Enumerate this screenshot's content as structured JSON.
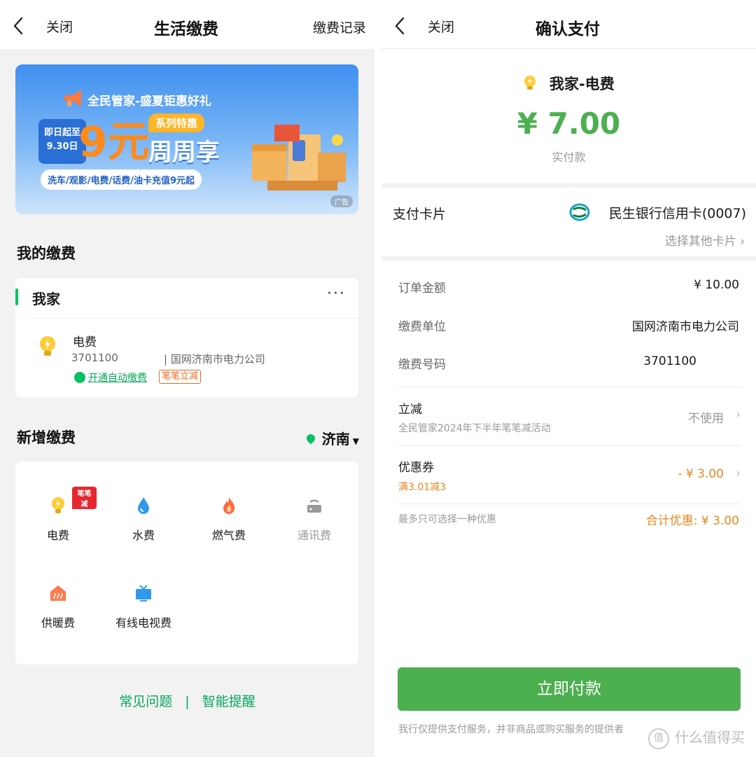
{
  "left": {
    "nav": {
      "close": "关闭",
      "title": "生活缴费",
      "right_link": "缴费记录"
    },
    "banner": {
      "title": "全民管家-盛夏钜惠好礼",
      "date_top": "即日起至",
      "date_bottom": "9.30日",
      "big": "9元",
      "series_tag": "系列特惠",
      "weekly": "周周享",
      "subtitle": "洗车/观影/电费/话费/油卡充值9元起",
      "ad_tag": "广告"
    },
    "my_bills": {
      "section_title": "我的缴费",
      "home_name": "我家",
      "more": "···",
      "bill": {
        "name": "电费",
        "number": "3701100",
        "company": "| 国网济南市电力公司",
        "auto_pay": "开通自动缴费",
        "promo_tag": "笔笔立减"
      }
    },
    "add_bills": {
      "section_title": "新增缴费",
      "city": "济南",
      "items": [
        {
          "label": "电费",
          "badge": "笔笔减",
          "icon": "bulb-icon"
        },
        {
          "label": "水费",
          "icon": "water-drop-icon"
        },
        {
          "label": "燃气费",
          "icon": "flame-icon"
        },
        {
          "label": "通讯费",
          "icon": "router-icon"
        },
        {
          "label": "供暖费",
          "icon": "heating-icon"
        },
        {
          "label": "有线电视费",
          "icon": "tv-icon"
        }
      ]
    },
    "footer": {
      "faq": "常见问题",
      "sep": "|",
      "reminder": "智能提醒"
    }
  },
  "right": {
    "nav": {
      "close": "关闭",
      "title": "确认支付"
    },
    "payee": "我家-电费",
    "amount": "¥ 7.00",
    "amount_caption": "实付款",
    "card": {
      "label": "支付卡片",
      "bank": "民生银行信用卡(0007)",
      "other": "选择其他卡片"
    },
    "details": {
      "order_amount_label": "订单金额",
      "order_amount": "¥ 10.00",
      "unit_label": "缴费单位",
      "unit": "国网济南市电力公司",
      "number_label": "缴费号码",
      "number": "3701100",
      "discount_label": "立减",
      "discount_sub": "全民管家2024年下半年笔笔减活动",
      "discount_value": "不使用",
      "coupon_label": "优惠券",
      "coupon_sub": "满3.01减3",
      "coupon_value": "- ¥ 3.00",
      "limit_note": "最多只可选择一种优惠",
      "total_discount": "合计优惠: ¥ 3.00"
    },
    "pay_button": "立即付款",
    "disclaimer": "我行仅提供支付服务，并非商品或购买服务的提供者",
    "watermark": "什么值得买",
    "watermark_logo": "值"
  },
  "colors": {
    "accent_green": "#4caf50",
    "brand_green": "#07c160",
    "orange": "#e8861e"
  }
}
